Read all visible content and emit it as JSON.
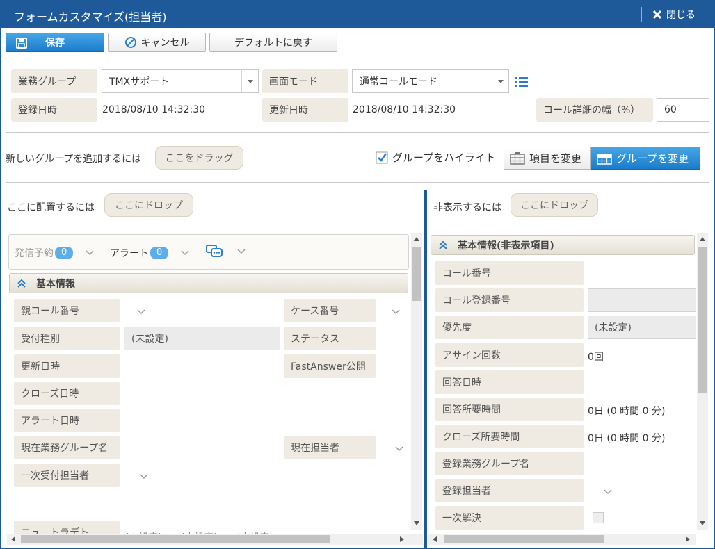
{
  "window": {
    "title": "フォームカスタマイズ(担当者)",
    "close_label": "閉じる"
  },
  "toolbar": {
    "save_label": "保存",
    "cancel_label": "キャンセル",
    "default_label": "デフォルトに戻す"
  },
  "form": {
    "business_group_label": "業務グループ",
    "business_group_value": "TMXサポート",
    "screen_mode_label": "画面モード",
    "screen_mode_value": "通常コールモード",
    "registered_label": "登録日時",
    "registered_value": "2018/08/10 14:32:30",
    "updated_label": "更新日時",
    "updated_value": "2018/08/10 14:32:30",
    "width_label": "コール詳細の幅（%）",
    "width_value": "60"
  },
  "group_bar": {
    "add_group_text": "新しいグループを追加するには",
    "drag_here": "ここをドラッグ",
    "highlight_label": "グループをハイライト",
    "change_item": "項目を変更",
    "change_group": "グループを変更"
  },
  "left": {
    "place_text": "ここに配置するには",
    "drop_here": "ここにドロップ",
    "tabs": {
      "schedule": "発信予約",
      "schedule_count": "0",
      "alert": "アラート",
      "alert_count": "0"
    },
    "section_title": "基本情報",
    "fields_col1": [
      "親コール番号",
      "受付種別",
      "更新日時",
      "クローズ日時",
      "アラート日時",
      "現在業務グループ名",
      "一次受付担当者"
    ],
    "receive_type_value": "(未設定)",
    "fields_col2": [
      "ケース番号",
      "ステータス",
      "FastAnswer公開",
      "現在担当者"
    ],
    "partial_row": [
      "ニュ－トラデト",
      "(未設定)",
      "(未設定)",
      "(未設定)"
    ]
  },
  "right": {
    "hide_text": "非表示するには",
    "drop_here": "ここにドロップ",
    "section_title": "基本情報(非表示項目)",
    "fields": [
      "コール番号",
      "コール登録番号",
      "優先度",
      "アサイン回数",
      "回答日時",
      "回答所要時間",
      "クローズ所要時間",
      "登録業務グループ名",
      "登録担当者",
      "一次解決"
    ],
    "priority_value": "(未設定)",
    "assign_value": "0回",
    "answer_time_value": "0日 (0 時間 0 分)",
    "close_time_value": "0日 (0 時間 0 分)"
  }
}
